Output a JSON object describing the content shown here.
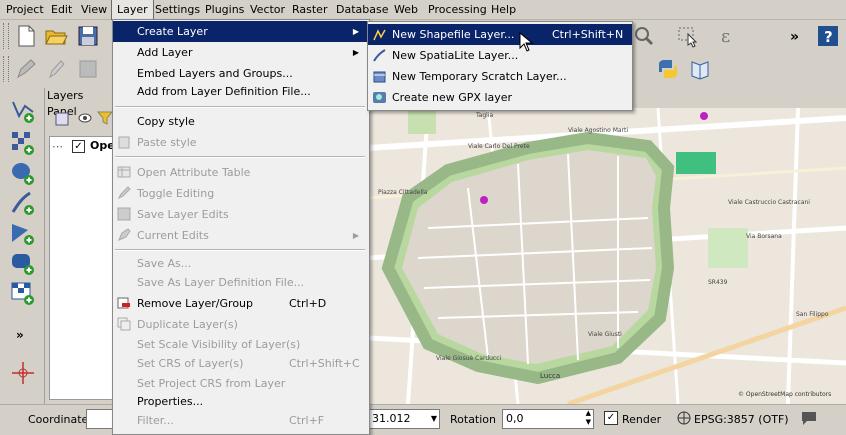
{
  "menubar": [
    "Project",
    "Edit",
    "View",
    "Layer",
    "Settings",
    "Plugins",
    "Vector",
    "Raster",
    "Database",
    "Web",
    "Processing",
    "Help"
  ],
  "layers_panel": {
    "title": "Layers Panel",
    "layer_name": "Ope"
  },
  "layer_menu": {
    "items": [
      {
        "label": "Create Layer",
        "shortcut": "",
        "submenu": true,
        "highlighted": true,
        "disabled": false
      },
      {
        "label": "Add Layer",
        "shortcut": "",
        "submenu": true,
        "disabled": false
      },
      {
        "label": "Embed Layers and Groups...",
        "shortcut": "",
        "disabled": false
      },
      {
        "label": "Add from Layer Definition File...",
        "shortcut": "",
        "disabled": false
      },
      {
        "label": "Copy style",
        "shortcut": "",
        "disabled": false
      },
      {
        "label": "Paste style",
        "shortcut": "",
        "disabled": true
      },
      {
        "label": "Open Attribute Table",
        "shortcut": "",
        "disabled": true
      },
      {
        "label": "Toggle Editing",
        "shortcut": "",
        "disabled": true
      },
      {
        "label": "Save Layer Edits",
        "shortcut": "",
        "disabled": true
      },
      {
        "label": "Current Edits",
        "shortcut": "",
        "submenu": true,
        "disabled": true
      },
      {
        "label": "Save As...",
        "shortcut": "",
        "disabled": true
      },
      {
        "label": "Save As Layer Definition File...",
        "shortcut": "",
        "disabled": true
      },
      {
        "label": "Remove Layer/Group",
        "shortcut": "Ctrl+D",
        "disabled": false
      },
      {
        "label": "Duplicate Layer(s)",
        "shortcut": "",
        "disabled": true
      },
      {
        "label": "Set Scale Visibility of Layer(s)",
        "shortcut": "",
        "disabled": true
      },
      {
        "label": "Set CRS of Layer(s)",
        "shortcut": "Ctrl+Shift+C",
        "disabled": true
      },
      {
        "label": "Set Project CRS from Layer",
        "shortcut": "",
        "disabled": true
      },
      {
        "label": "Properties...",
        "shortcut": "",
        "disabled": false
      },
      {
        "label": "Filter...",
        "shortcut": "Ctrl+F",
        "disabled": true
      }
    ]
  },
  "create_layer_submenu": {
    "items": [
      {
        "label": "New Shapefile Layer...",
        "shortcut": "Ctrl+Shift+N",
        "highlighted": true
      },
      {
        "label": "New SpatiaLite Layer...",
        "shortcut": ""
      },
      {
        "label": "New Temporary Scratch Layer...",
        "shortcut": ""
      },
      {
        "label": "Create new GPX layer",
        "shortcut": ""
      }
    ]
  },
  "map": {
    "labels": [
      "Viale Agostino Marti",
      "Viale Carlo Del Prete",
      "Lucca",
      "Viale Castruccio Castracani",
      "Via Borsana",
      "Piazza Cittadella",
      "Viale Giusti",
      "Viale Giosuè Carducci",
      "Taglia",
      "SR439",
      "San Filippo"
    ],
    "attribution": "© OpenStreetMap contributors"
  },
  "statusbar": {
    "coordinate_label": "Coordinate",
    "coordinate_value": "",
    "scale_value": "31.012",
    "rotation_label": "Rotation",
    "rotation_value": "0,0",
    "render_label": "Render",
    "render_checked": true,
    "crs": "EPSG:3857 (OTF)"
  },
  "colors": {
    "menu_highlight": "#0a246a",
    "chrome": "#d4d0c8",
    "map_bg": "#e8e2d8",
    "walls_green": "#a8d08c"
  }
}
